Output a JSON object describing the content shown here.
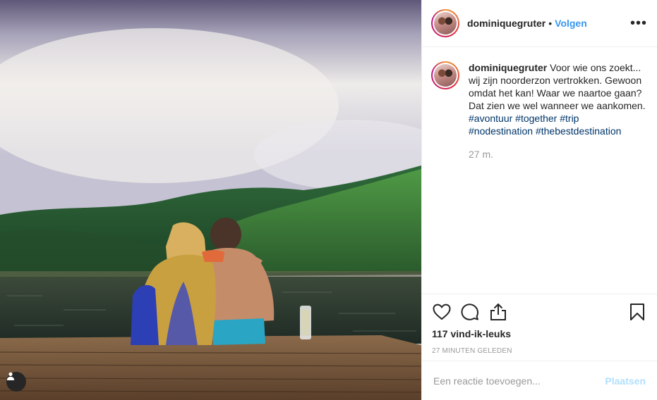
{
  "post": {
    "username": "dominiquegruter",
    "follow_label": "Volgen",
    "separator": "•",
    "more_label": "•••",
    "caption": {
      "username": "dominiquegruter",
      "text": "Voor wie ons zoekt... wij zijn noorderzon vertrokken. Gewoon omdat het kan! Waar we naartoe gaan? Dat zien we wel wanneer we aankomen.",
      "hashtags": [
        "#avontuur",
        "#together",
        "#trip",
        "#nodestination",
        "#thebestdestination"
      ],
      "time": "27 m."
    },
    "likes": "117 vind-ik-leuks",
    "time_ago": "27 MINUTEN GELEDEN",
    "comment": {
      "placeholder": "Een reactie toevoegen...",
      "post_label": "Plaatsen"
    },
    "icons": [
      "heart-icon",
      "comment-icon",
      "share-icon",
      "bookmark-icon",
      "user-tag-icon"
    ],
    "colors": {
      "link": "#3897f0",
      "hashtag": "#003569",
      "muted": "#999999",
      "post_button_disabled": "#b2dffc"
    }
  }
}
